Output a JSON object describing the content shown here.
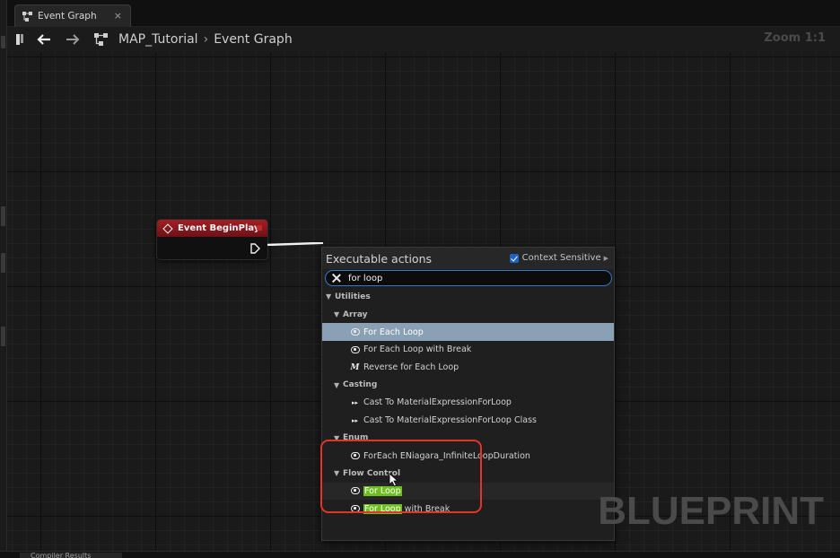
{
  "tab": {
    "label": "Event Graph",
    "close": "×"
  },
  "toolbar": {
    "breadcrumb": [
      "MAP_Tutorial",
      "Event Graph"
    ],
    "separator": "›",
    "zoom": "Zoom 1:1"
  },
  "node": {
    "title": "Event BeginPlay",
    "header_color": "#a41f25"
  },
  "palette": {
    "title": "Executable actions",
    "context_sensitive": {
      "label": "Context Sensitive",
      "checked": true
    },
    "search": {
      "value": "for loop"
    },
    "tree": [
      {
        "type": "category",
        "label": "Utilities"
      },
      {
        "type": "subcategory",
        "label": "Array"
      },
      {
        "type": "item",
        "icon": "for-each-loop-icon",
        "label": "For Each Loop",
        "selected": true
      },
      {
        "type": "item",
        "icon": "loop-icon",
        "label": "For Each Loop with Break"
      },
      {
        "type": "item",
        "icon": "macro-icon",
        "icon_glyph": "M",
        "label": "Reverse for Each Loop"
      },
      {
        "type": "subcategory",
        "label": "Casting"
      },
      {
        "type": "item",
        "icon": "cast-icon",
        "icon_glyph": "▸▸",
        "label": "Cast To MaterialExpressionForLoop"
      },
      {
        "type": "item",
        "icon": "cast-icon",
        "icon_glyph": "▸▸",
        "label": "Cast To MaterialExpressionForLoop Class"
      },
      {
        "type": "subcategory",
        "label": "Enum"
      },
      {
        "type": "item",
        "icon": "loop-icon",
        "label": "ForEach ENiagara_InfiniteLoopDuration"
      },
      {
        "type": "subcategory",
        "label": "Flow Control"
      },
      {
        "type": "item",
        "icon": "loop-icon",
        "label": "For Loop",
        "highlight": "For Loop",
        "rest": "",
        "hover": true
      },
      {
        "type": "item",
        "icon": "loop-icon",
        "label": "For Loop with Break",
        "highlight": "For Loop",
        "rest": " with Break"
      }
    ]
  },
  "watermark": "BLUEPRINT",
  "bottom_tab": {
    "label": "Compiler Results"
  },
  "colors": {
    "selection": "#8aa0b4",
    "highlight": "#6fbf21",
    "annotation": "#e2342b",
    "search_border": "#2f79c6"
  }
}
